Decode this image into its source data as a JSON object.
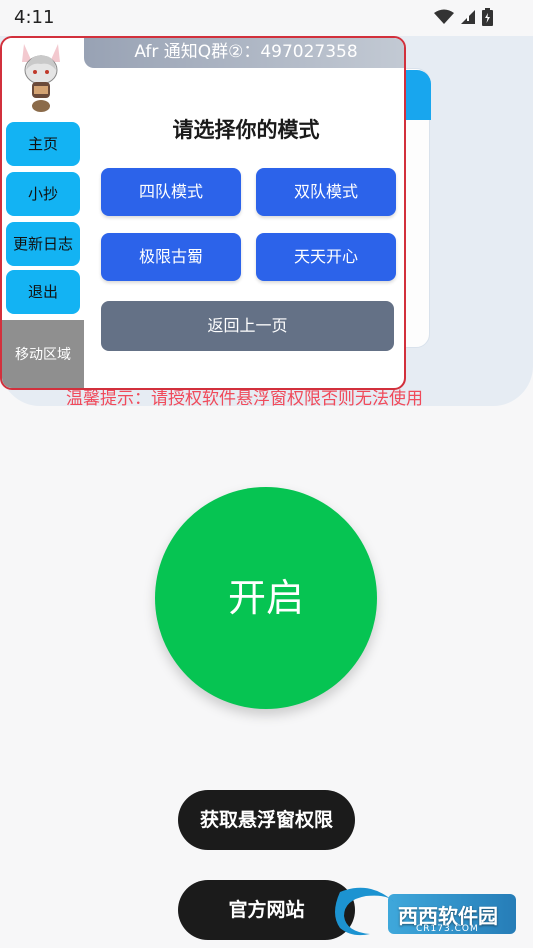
{
  "status_bar": {
    "time": "4:11",
    "icons": [
      "wifi-icon",
      "signal-icon",
      "battery-icon"
    ]
  },
  "floating_window": {
    "header": "Afr 通知Q群②：497027358",
    "sidebar": {
      "items": [
        {
          "label": "主页"
        },
        {
          "label": "小抄"
        },
        {
          "label": "更新日志"
        },
        {
          "label": "退出"
        }
      ],
      "move_area": "移动区域"
    },
    "title": "请选择你的模式",
    "modes": [
      {
        "label": "四队模式"
      },
      {
        "label": "双队模式"
      },
      {
        "label": "极限古蜀"
      },
      {
        "label": "天天开心"
      }
    ],
    "back": "返回上一页"
  },
  "warning": "温馨提示：请授权软件悬浮窗权限否则无法使用",
  "main": {
    "start": "开启",
    "get_permission": "获取悬浮窗权限",
    "official_site": "官方网站"
  },
  "watermark": {
    "text": "西西软件园",
    "sub": "CR173.COM"
  },
  "colors": {
    "start": "#06c452",
    "mode_button": "#2c63ea",
    "sidebar_button": "#13b3f3",
    "back_button": "#647186",
    "warning": "#f04a5a",
    "window_border": "#d2303c"
  }
}
